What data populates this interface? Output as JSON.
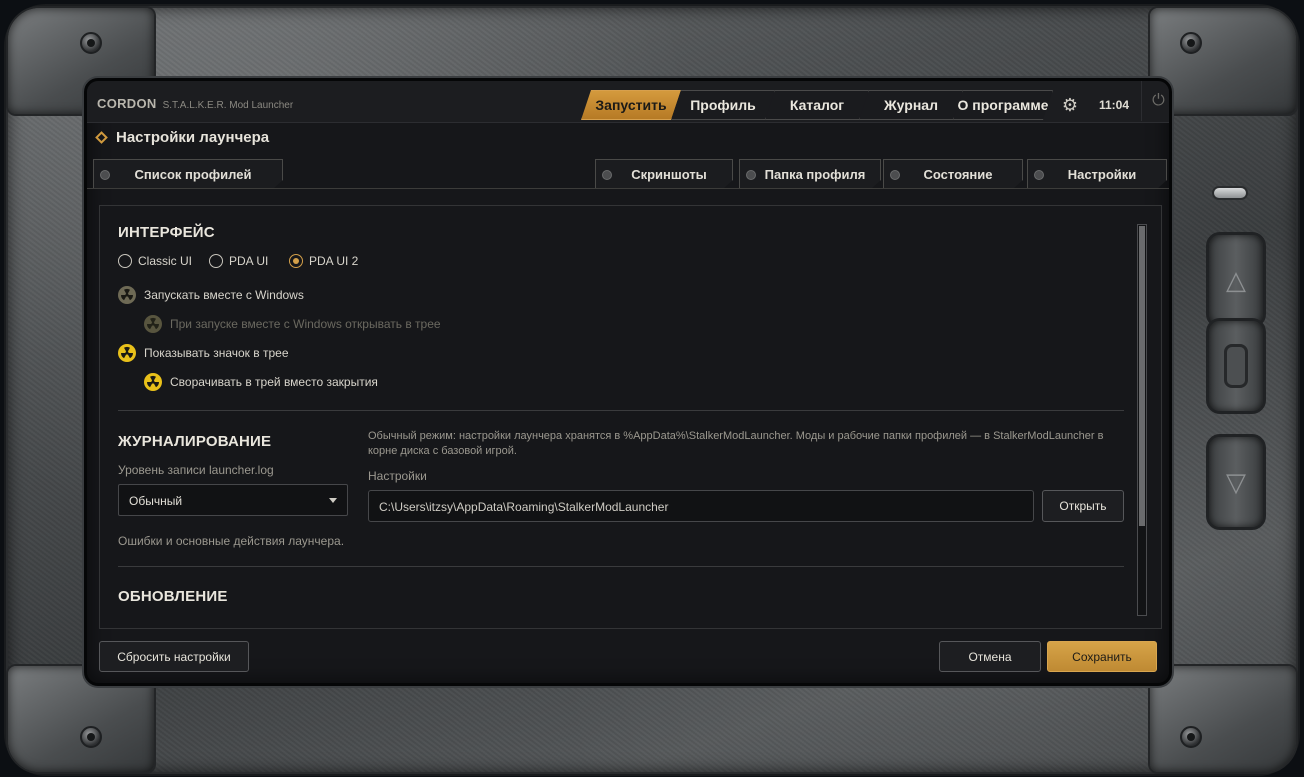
{
  "app": {
    "logo": "CORDON",
    "subtitle": "S.T.A.L.K.E.R. Mod Launcher"
  },
  "nav": {
    "tabs": [
      {
        "label": "Запустить",
        "active": true
      },
      {
        "label": "Профиль"
      },
      {
        "label": "Каталог"
      },
      {
        "label": "Журнал"
      },
      {
        "label": "О программе"
      }
    ],
    "settings_icon": "gear-icon",
    "clock": "11:04",
    "power_icon": "power-icon"
  },
  "page": {
    "title": "Настройки лаунчера",
    "title_icon": "diamond-icon"
  },
  "subtabs": {
    "profiles": "Список профилей",
    "screenshots": "Скриншоты",
    "profile_folder": "Папка профиля",
    "state": "Состояние",
    "settings": "Настройки"
  },
  "interface": {
    "heading": "ИНТЕРФЕЙС",
    "ui_options": [
      "Classic UI",
      "PDA UI",
      "PDA UI 2"
    ],
    "selected_ui": "PDA UI 2",
    "autostart": "Запускать вместе с Windows",
    "autostart_tray": "При запуске вместе с Windows открывать в трее",
    "show_tray_icon": "Показывать значок в трее",
    "minimize_to_tray": "Сворачивать в трей вместо закрытия"
  },
  "logging": {
    "heading": "ЖУРНАЛИРОВАНИЕ",
    "level_label": "Уровень записи launcher.log",
    "level_value": "Обычный",
    "level_hint": "Ошибки и основные действия лаунчера.",
    "mode_note": "Обычный режим: настройки лаунчера хранятся в %AppData%\\StalkerModLauncher. Моды и рабочие папки профилей — в StalkerModLauncher в корне диска с базовой игрой.",
    "settings_label": "Настройки",
    "settings_path": "C:\\Users\\itzsy\\AppData\\Roaming\\StalkerModLauncher",
    "open_button": "Открыть"
  },
  "update": {
    "heading": "ОБНОВЛЕНИЕ"
  },
  "footer": {
    "reset": "Сбросить настройки",
    "cancel": "Отмена",
    "save": "Сохранить"
  },
  "colors": {
    "accent": "#cc9236",
    "radiation_on": "#e9c11a"
  }
}
